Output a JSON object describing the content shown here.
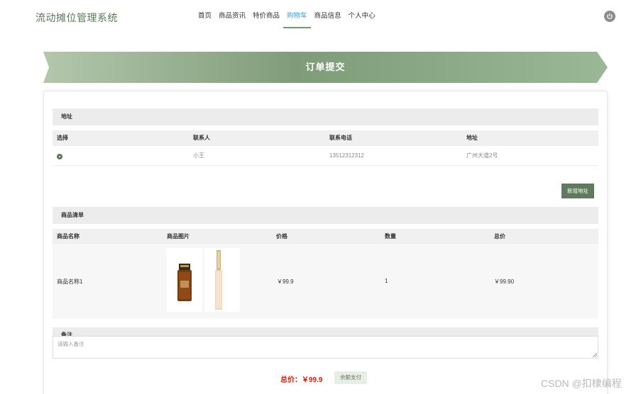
{
  "header": {
    "brand": "流动摊位管理系统",
    "nav": [
      {
        "label": "首页",
        "active": false
      },
      {
        "label": "商品资讯",
        "active": false
      },
      {
        "label": "特价商品",
        "active": false
      },
      {
        "label": "购物车",
        "active": true
      },
      {
        "label": "商品信息",
        "active": false
      },
      {
        "label": "个人中心",
        "active": false
      }
    ],
    "power_icon": "power-icon"
  },
  "banner": {
    "title": "订单提交"
  },
  "address": {
    "section_title": "地址",
    "columns": [
      "选择",
      "联系人",
      "联系电话",
      "地址"
    ],
    "rows": [
      {
        "selected": true,
        "contact": "小王",
        "phone": "13512312312",
        "address": "广州大道2号"
      }
    ],
    "add_button": "新增地址"
  },
  "products": {
    "section_title": "商品清单",
    "columns": [
      "商品名称",
      "商品图片",
      "价格",
      "数量",
      "总价"
    ],
    "rows": [
      {
        "name": "商品名称1",
        "price": "￥99.9",
        "quantity": "1",
        "total": "￥99.90",
        "images": [
          "serum-bottle-image",
          "foundation-tube-image"
        ]
      }
    ]
  },
  "note": {
    "title": "备注",
    "placeholder": "请输入备注"
  },
  "footer": {
    "total_label": "总价：￥99.9",
    "pay_button": "余额支付"
  },
  "watermark": "CSDN @扣棣编程",
  "colors": {
    "accent_green": "#5f7a5c",
    "active_nav": "#3a9ee0",
    "total_red": "#d81e06"
  }
}
